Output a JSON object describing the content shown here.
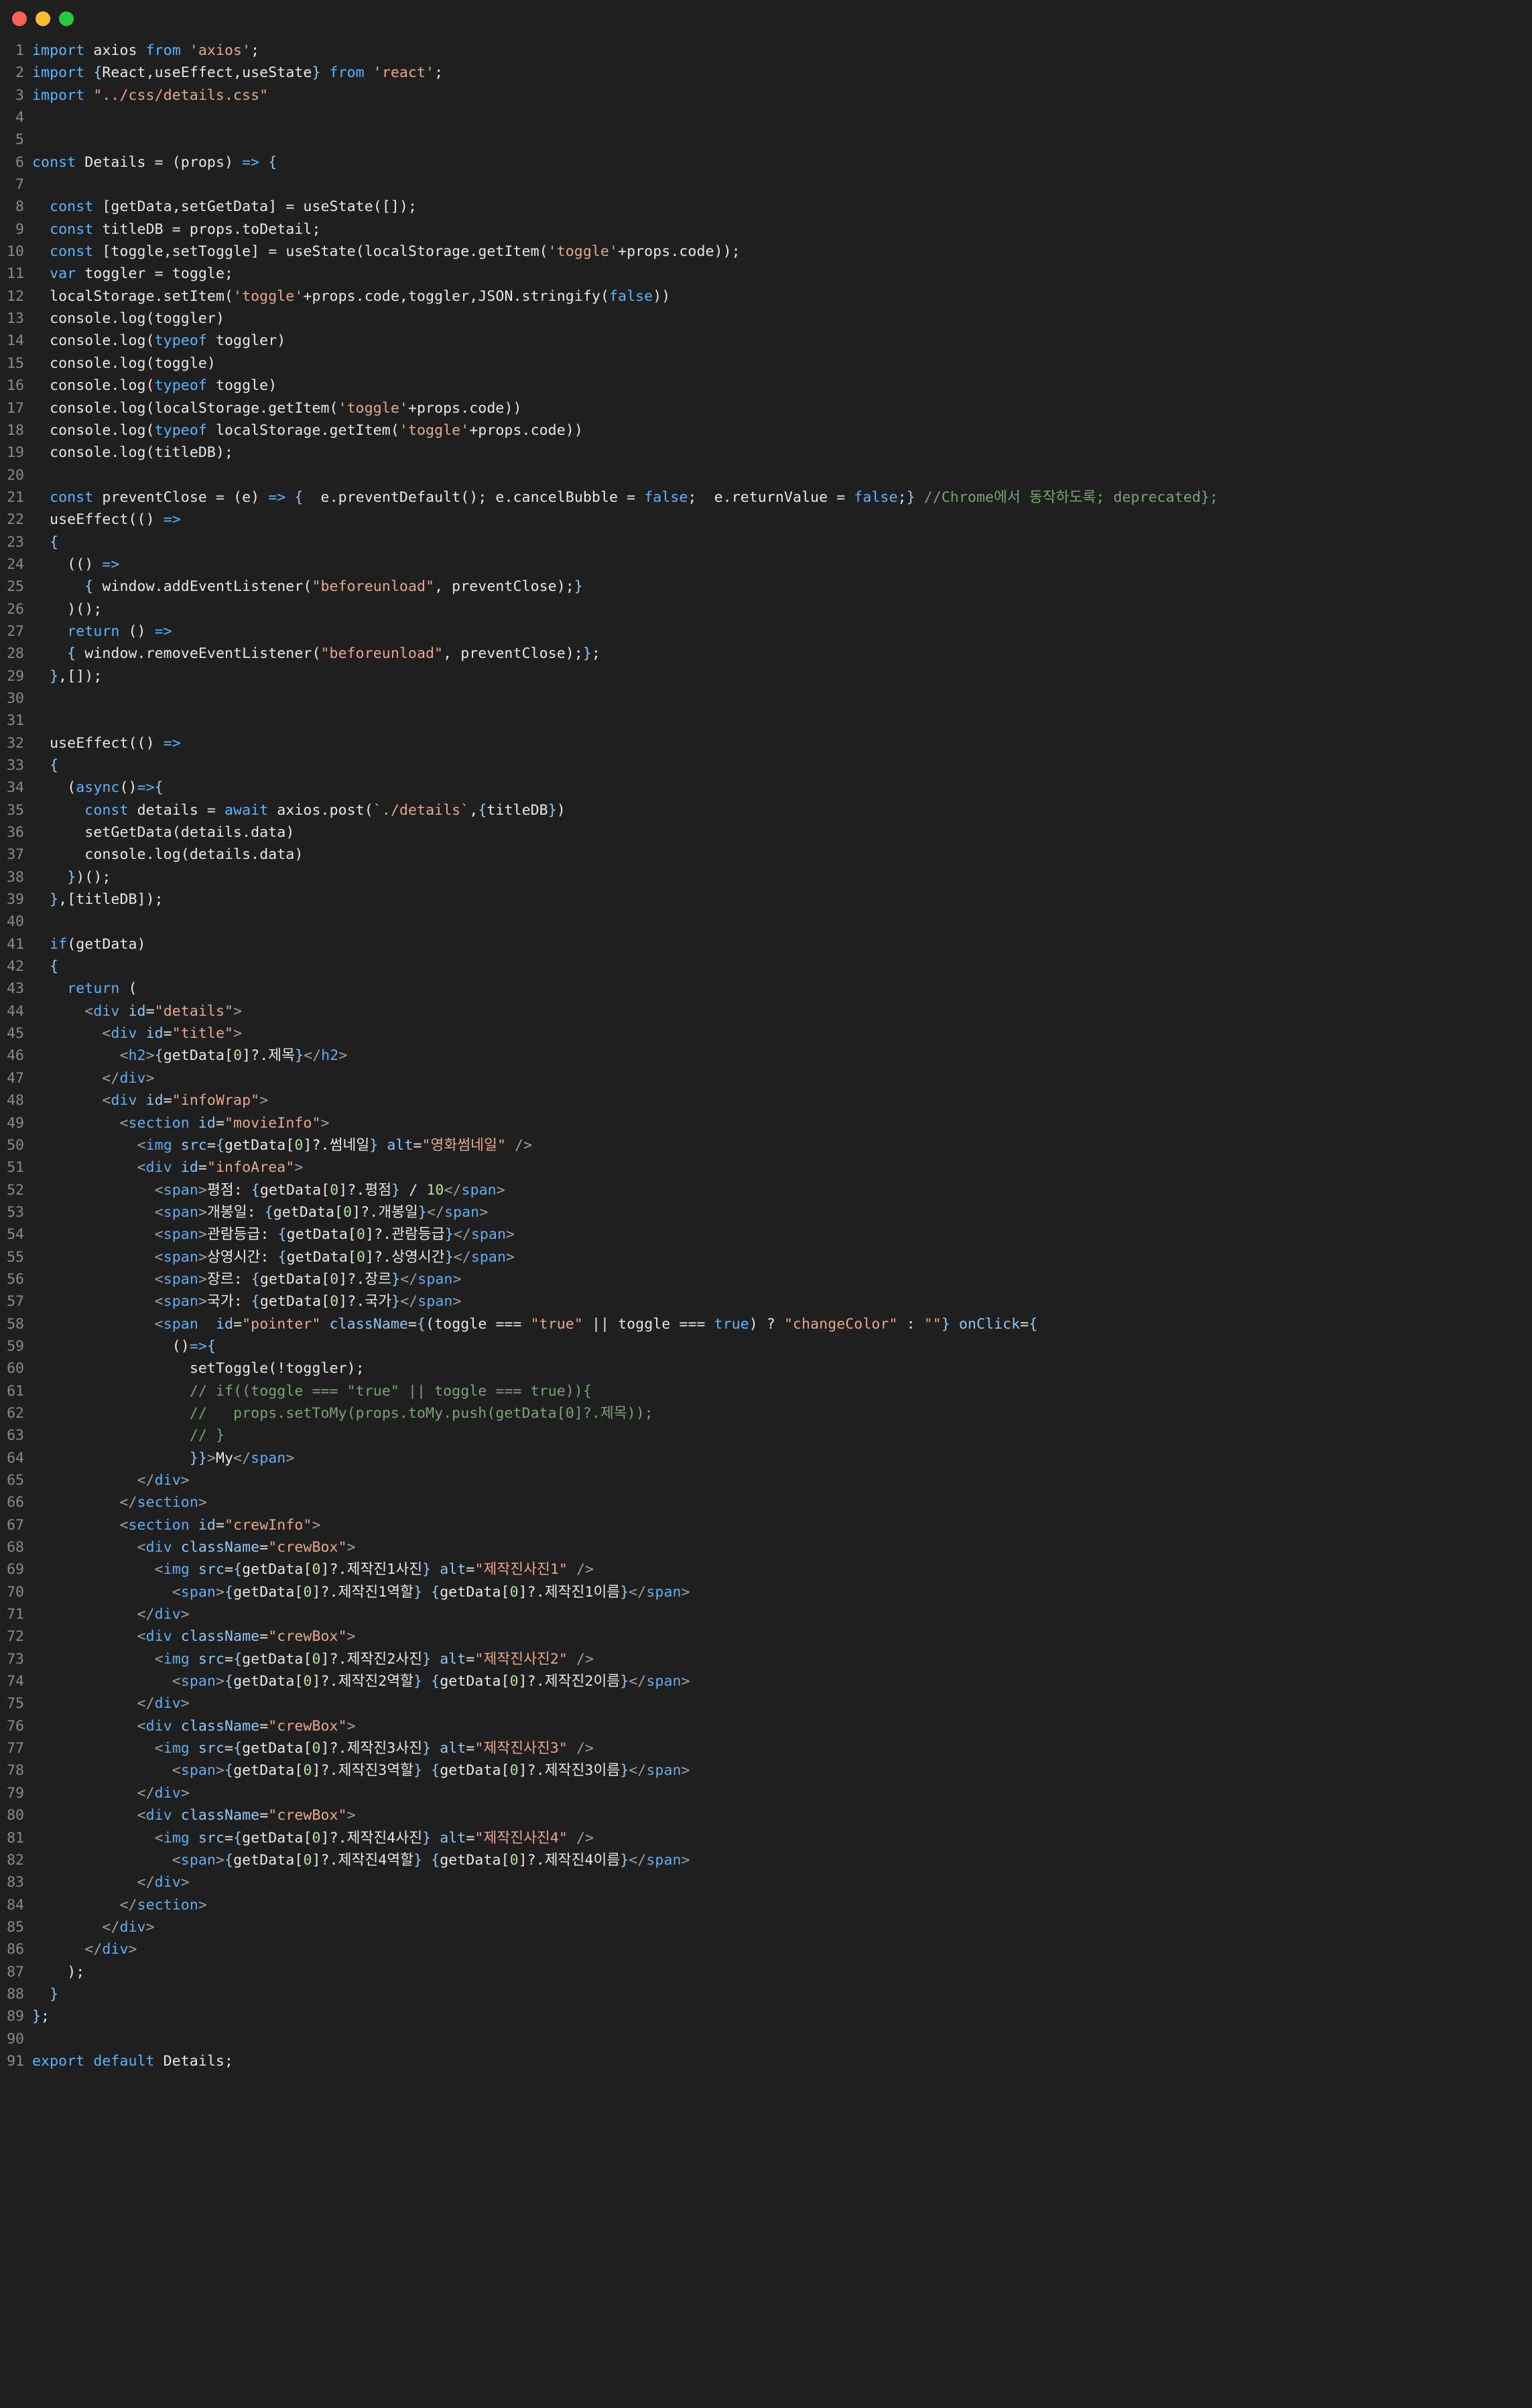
{
  "window": {
    "title": "",
    "traffic_lights": [
      {
        "name": "close",
        "color": "#FF5F57"
      },
      {
        "name": "minimize",
        "color": "#FEBC2E"
      },
      {
        "name": "maximize",
        "color": "#28C840"
      }
    ],
    "background": "#1f1f1f",
    "language": "jsx"
  },
  "theme": {
    "keyword": "#56b6ff",
    "string": "#e8a88a",
    "comment": "#79a473",
    "plain": "#e8e8e8",
    "tag": "#61afef",
    "attribute": "#8fc7f5",
    "number": "#b5e0a0",
    "linenumber": "#8a8a8a"
  },
  "code": {
    "first_line": 1,
    "last_line": 91,
    "lines": [
      {
        "n": 1,
        "text": "import axios from 'axios';"
      },
      {
        "n": 2,
        "text": "import {React,useEffect,useState} from 'react';"
      },
      {
        "n": 3,
        "text": "import \"../css/details.css\""
      },
      {
        "n": 4,
        "text": ""
      },
      {
        "n": 5,
        "text": ""
      },
      {
        "n": 6,
        "text": "const Details = (props) => {"
      },
      {
        "n": 7,
        "text": ""
      },
      {
        "n": 8,
        "text": "  const [getData,setGetData] = useState([]);"
      },
      {
        "n": 9,
        "text": "  const titleDB = props.toDetail;"
      },
      {
        "n": 10,
        "text": "  const [toggle,setToggle] = useState(localStorage.getItem('toggle'+props.code));"
      },
      {
        "n": 11,
        "text": "  var toggler = toggle;"
      },
      {
        "n": 12,
        "text": "  localStorage.setItem('toggle'+props.code,toggler,JSON.stringify(false))"
      },
      {
        "n": 13,
        "text": "  console.log(toggler)"
      },
      {
        "n": 14,
        "text": "  console.log(typeof toggler)"
      },
      {
        "n": 15,
        "text": "  console.log(toggle)"
      },
      {
        "n": 16,
        "text": "  console.log(typeof toggle)"
      },
      {
        "n": 17,
        "text": "  console.log(localStorage.getItem('toggle'+props.code))"
      },
      {
        "n": 18,
        "text": "  console.log(typeof localStorage.getItem('toggle'+props.code))"
      },
      {
        "n": 19,
        "text": "  console.log(titleDB);"
      },
      {
        "n": 20,
        "text": ""
      },
      {
        "n": 21,
        "text": "  const preventClose = (e) => {  e.preventDefault(); e.cancelBubble = false;  e.returnValue = false;} //Chrome에서 동작하도록; deprecated};"
      },
      {
        "n": 22,
        "text": "  useEffect(() =>"
      },
      {
        "n": 23,
        "text": "  {"
      },
      {
        "n": 24,
        "text": "    (() =>"
      },
      {
        "n": 25,
        "text": "      { window.addEventListener(\"beforeunload\", preventClose);}"
      },
      {
        "n": 26,
        "text": "    )();"
      },
      {
        "n": 27,
        "text": "    return () =>"
      },
      {
        "n": 28,
        "text": "    { window.removeEventListener(\"beforeunload\", preventClose);};"
      },
      {
        "n": 29,
        "text": "  },[]);"
      },
      {
        "n": 30,
        "text": ""
      },
      {
        "n": 31,
        "text": ""
      },
      {
        "n": 32,
        "text": "  useEffect(() =>"
      },
      {
        "n": 33,
        "text": "  {"
      },
      {
        "n": 34,
        "text": "    (async()=>{"
      },
      {
        "n": 35,
        "text": "      const details = await axios.post(`./details`,{titleDB})"
      },
      {
        "n": 36,
        "text": "      setGetData(details.data)"
      },
      {
        "n": 37,
        "text": "      console.log(details.data)"
      },
      {
        "n": 38,
        "text": "    })();"
      },
      {
        "n": 39,
        "text": "  },[titleDB]);"
      },
      {
        "n": 40,
        "text": ""
      },
      {
        "n": 41,
        "text": "  if(getData)"
      },
      {
        "n": 42,
        "text": "  {"
      },
      {
        "n": 43,
        "text": "    return ("
      },
      {
        "n": 44,
        "text": "      <div id=\"details\">"
      },
      {
        "n": 45,
        "text": "        <div id=\"title\">"
      },
      {
        "n": 46,
        "text": "          <h2>{getData[0]?.제목}</h2>"
      },
      {
        "n": 47,
        "text": "        </div>"
      },
      {
        "n": 48,
        "text": "        <div id=\"infoWrap\">"
      },
      {
        "n": 49,
        "text": "          <section id=\"movieInfo\">"
      },
      {
        "n": 50,
        "text": "            <img src={getData[0]?.썸네일} alt=\"영화썸네일\" />"
      },
      {
        "n": 51,
        "text": "            <div id=\"infoArea\">"
      },
      {
        "n": 52,
        "text": "              <span>평점: {getData[0]?.평점} / 10</span>"
      },
      {
        "n": 53,
        "text": "              <span>개봉일: {getData[0]?.개봉일}</span>"
      },
      {
        "n": 54,
        "text": "              <span>관람등급: {getData[0]?.관람등급}</span>"
      },
      {
        "n": 55,
        "text": "              <span>상영시간: {getData[0]?.상영시간}</span>"
      },
      {
        "n": 56,
        "text": "              <span>장르: {getData[0]?.장르}</span>"
      },
      {
        "n": 57,
        "text": "              <span>국가: {getData[0]?.국가}</span>"
      },
      {
        "n": 58,
        "text": "              <span  id=\"pointer\" className={(toggle === \"true\" || toggle === true) ? \"changeColor\" : \"\"} onClick={"
      },
      {
        "n": 59,
        "text": "                ()=>{"
      },
      {
        "n": 60,
        "text": "                  setToggle(!toggler);"
      },
      {
        "n": 61,
        "text": "                  // if((toggle === \"true\" || toggle === true)){"
      },
      {
        "n": 62,
        "text": "                  //   props.setToMy(props.toMy.push(getData[0]?.제목));"
      },
      {
        "n": 63,
        "text": "                  // }"
      },
      {
        "n": 64,
        "text": "                  }}>My</span>"
      },
      {
        "n": 65,
        "text": "            </div>"
      },
      {
        "n": 66,
        "text": "          </section>"
      },
      {
        "n": 67,
        "text": "          <section id=\"crewInfo\">"
      },
      {
        "n": 68,
        "text": "            <div className=\"crewBox\">"
      },
      {
        "n": 69,
        "text": "              <img src={getData[0]?.제작진1사진} alt=\"제작진사진1\" />"
      },
      {
        "n": 70,
        "text": "                <span>{getData[0]?.제작진1역할} {getData[0]?.제작진1이름}</span>"
      },
      {
        "n": 71,
        "text": "            </div>"
      },
      {
        "n": 72,
        "text": "            <div className=\"crewBox\">"
      },
      {
        "n": 73,
        "text": "              <img src={getData[0]?.제작진2사진} alt=\"제작진사진2\" />"
      },
      {
        "n": 74,
        "text": "                <span>{getData[0]?.제작진2역할} {getData[0]?.제작진2이름}</span>"
      },
      {
        "n": 75,
        "text": "            </div>"
      },
      {
        "n": 76,
        "text": "            <div className=\"crewBox\">"
      },
      {
        "n": 77,
        "text": "              <img src={getData[0]?.제작진3사진} alt=\"제작진사진3\" />"
      },
      {
        "n": 78,
        "text": "                <span>{getData[0]?.제작진3역할} {getData[0]?.제작진3이름}</span>"
      },
      {
        "n": 79,
        "text": "            </div>"
      },
      {
        "n": 80,
        "text": "            <div className=\"crewBox\">"
      },
      {
        "n": 81,
        "text": "              <img src={getData[0]?.제작진4사진} alt=\"제작진사진4\" />"
      },
      {
        "n": 82,
        "text": "                <span>{getData[0]?.제작진4역할} {getData[0]?.제작진4이름}</span>"
      },
      {
        "n": 83,
        "text": "            </div>"
      },
      {
        "n": 84,
        "text": "          </section>"
      },
      {
        "n": 85,
        "text": "        </div>"
      },
      {
        "n": 86,
        "text": "      </div>"
      },
      {
        "n": 87,
        "text": "    );"
      },
      {
        "n": 88,
        "text": "  }"
      },
      {
        "n": 89,
        "text": "};"
      },
      {
        "n": 90,
        "text": ""
      },
      {
        "n": 91,
        "text": "export default Details;"
      }
    ]
  }
}
